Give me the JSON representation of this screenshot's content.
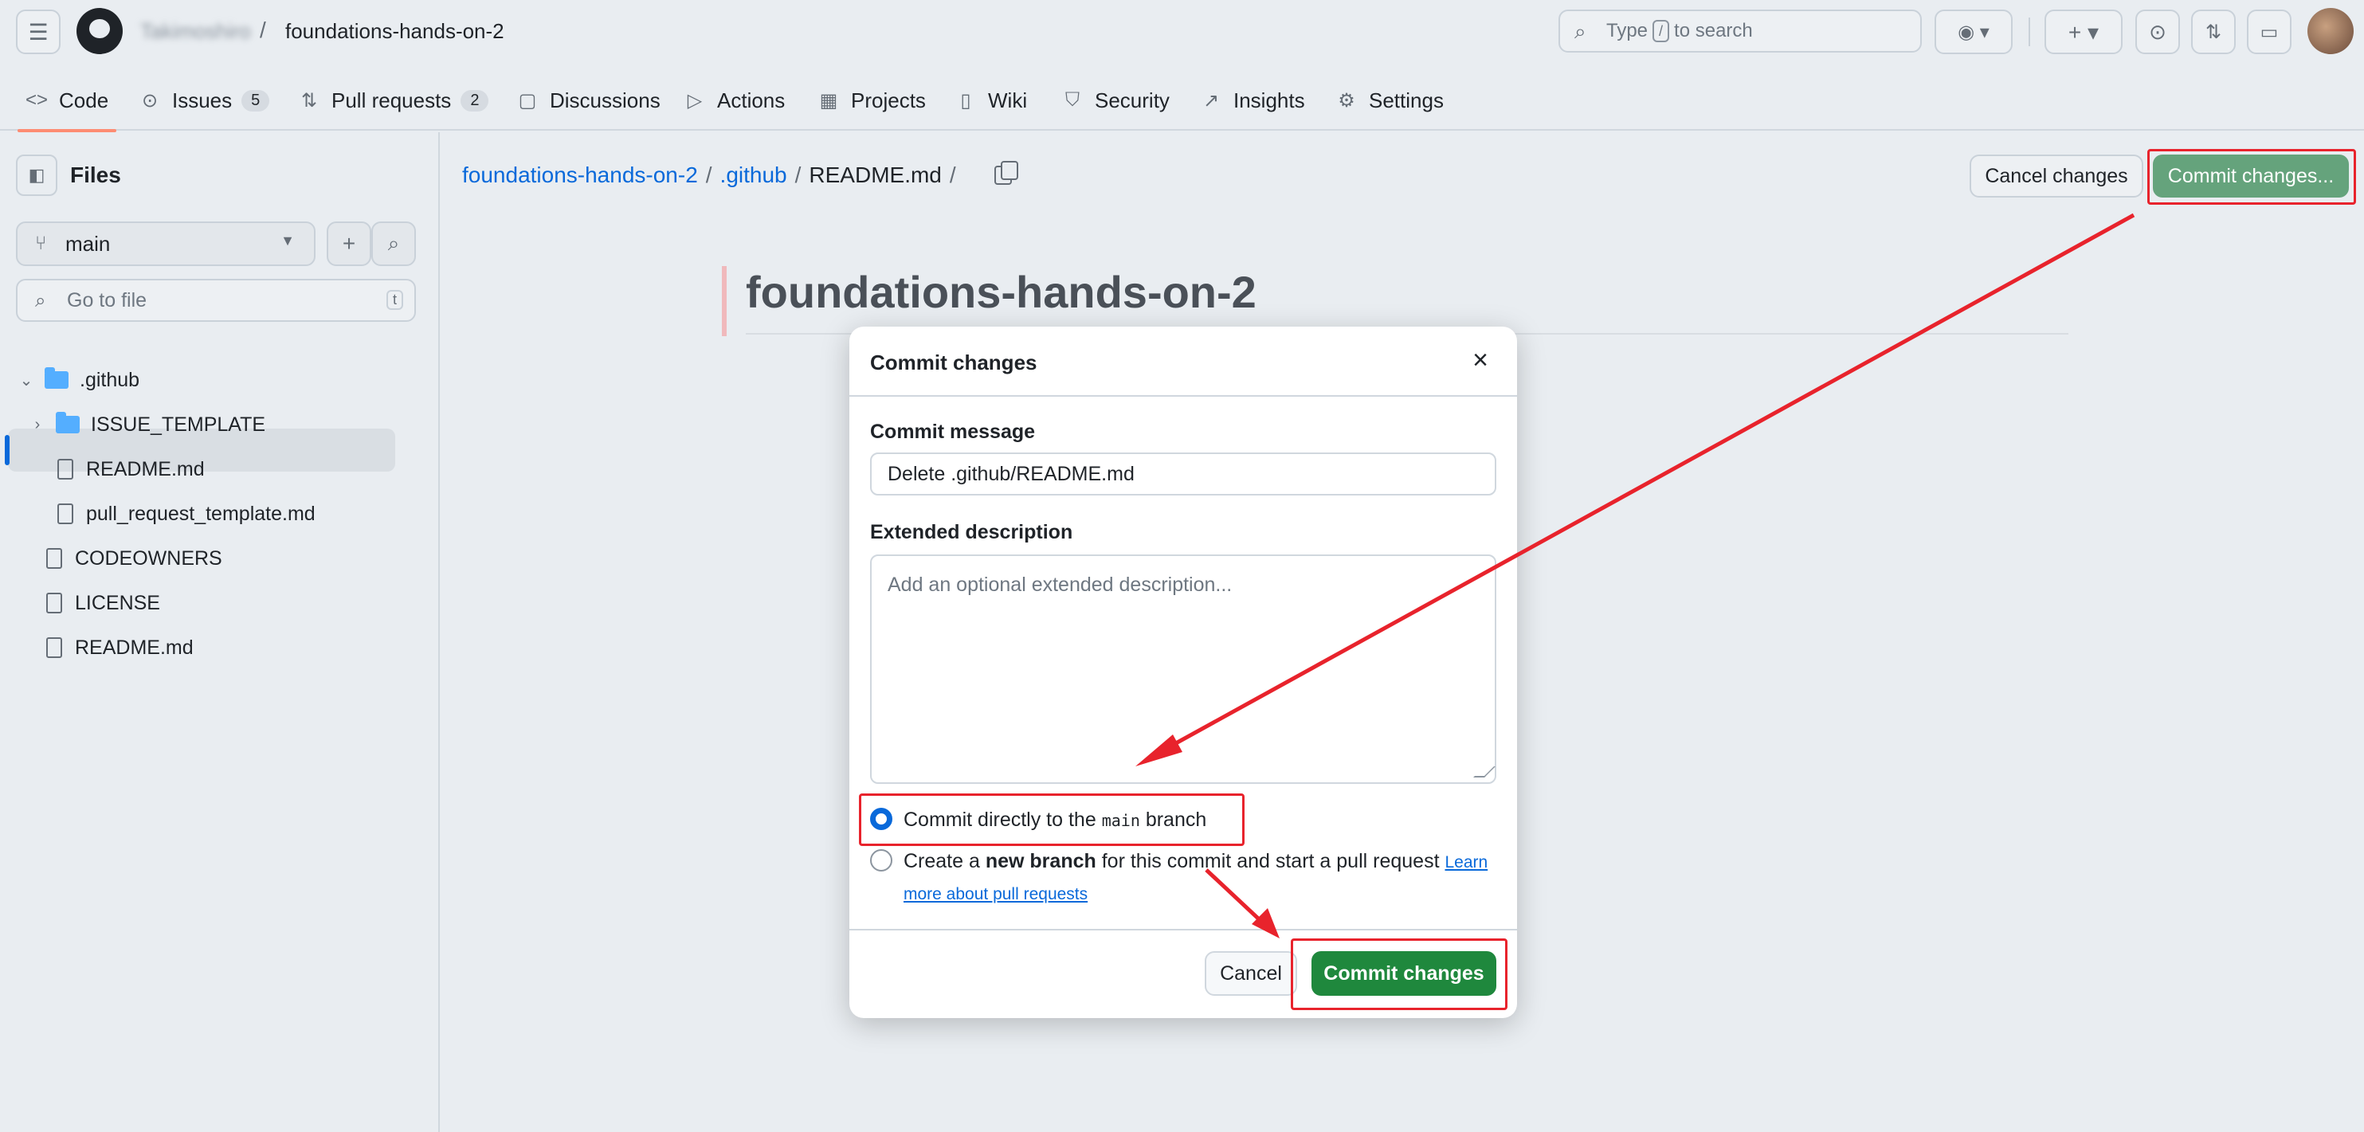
{
  "header": {
    "owner": "Takimoshiro",
    "separator": "/",
    "repo": "foundations-hands-on-2",
    "search_prefix": "Type",
    "search_key": "/",
    "search_suffix": "to search"
  },
  "tabs": [
    {
      "label": "Code",
      "icon": "code-icon"
    },
    {
      "label": "Issues",
      "count": "5",
      "icon": "issue-icon"
    },
    {
      "label": "Pull requests",
      "count": "2",
      "icon": "pull-request-icon"
    },
    {
      "label": "Discussions",
      "icon": "discussion-icon"
    },
    {
      "label": "Actions",
      "icon": "play-icon"
    },
    {
      "label": "Projects",
      "icon": "table-icon"
    },
    {
      "label": "Wiki",
      "icon": "book-icon"
    },
    {
      "label": "Security",
      "icon": "shield-icon"
    },
    {
      "label": "Insights",
      "icon": "graph-icon"
    },
    {
      "label": "Settings",
      "icon": "gear-icon"
    }
  ],
  "sidebar": {
    "title": "Files",
    "branch": "main",
    "goto_placeholder": "Go to file",
    "goto_key": "t",
    "tree": [
      {
        "label": ".github",
        "type": "folder",
        "expanded": true
      },
      {
        "label": "ISSUE_TEMPLATE",
        "type": "folder",
        "expanded": false
      },
      {
        "label": "README.md",
        "type": "file",
        "selected": true
      },
      {
        "label": "pull_request_template.md",
        "type": "file"
      },
      {
        "label": "CODEOWNERS",
        "type": "file"
      },
      {
        "label": "LICENSE",
        "type": "file"
      },
      {
        "label": "README.md",
        "type": "file"
      }
    ]
  },
  "breadcrumb": {
    "repo": "foundations-hands-on-2",
    "folder": ".github",
    "file": "README.md",
    "sep": "/"
  },
  "actions": {
    "cancel": "Cancel changes",
    "commit": "Commit changes..."
  },
  "readme": {
    "heading": "foundations-hands-on-2"
  },
  "dialog": {
    "title": "Commit changes",
    "close_icon": "×",
    "message_label": "Commit message",
    "message_value": "Delete .github/README.md",
    "description_label": "Extended description",
    "description_placeholder": "Add an optional extended description...",
    "option_direct_pre": "Commit directly to the",
    "option_direct_branch": "main",
    "option_direct_post": "branch",
    "option_direct_selected": true,
    "option_new_pre": "Create a",
    "option_new_bold": "new branch",
    "option_new_post": "for this commit and start a pull request",
    "option_new_link_1": "Learn",
    "option_new_link_2": "more about pull requests",
    "cancel": "Cancel",
    "commit": "Commit changes"
  },
  "colors": {
    "primary_green": "#1f883d",
    "annotation_red": "#e8232c",
    "link_blue": "#0969da"
  }
}
